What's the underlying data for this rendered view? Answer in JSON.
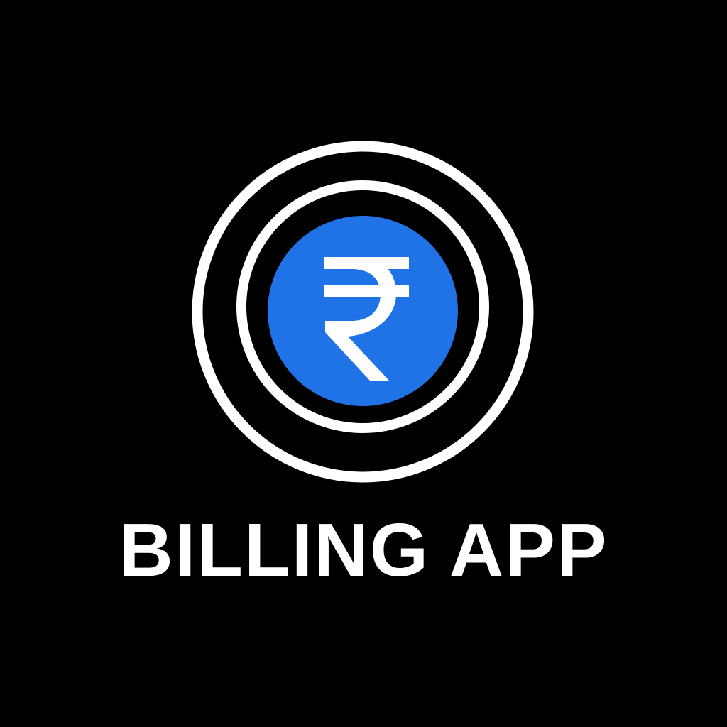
{
  "brand": {
    "title": "BILLING APP",
    "icon": "rupee-icon",
    "colors": {
      "background": "#000000",
      "ring": "#ffffff",
      "accent": "#1f73e6",
      "text": "#ffffff"
    }
  }
}
